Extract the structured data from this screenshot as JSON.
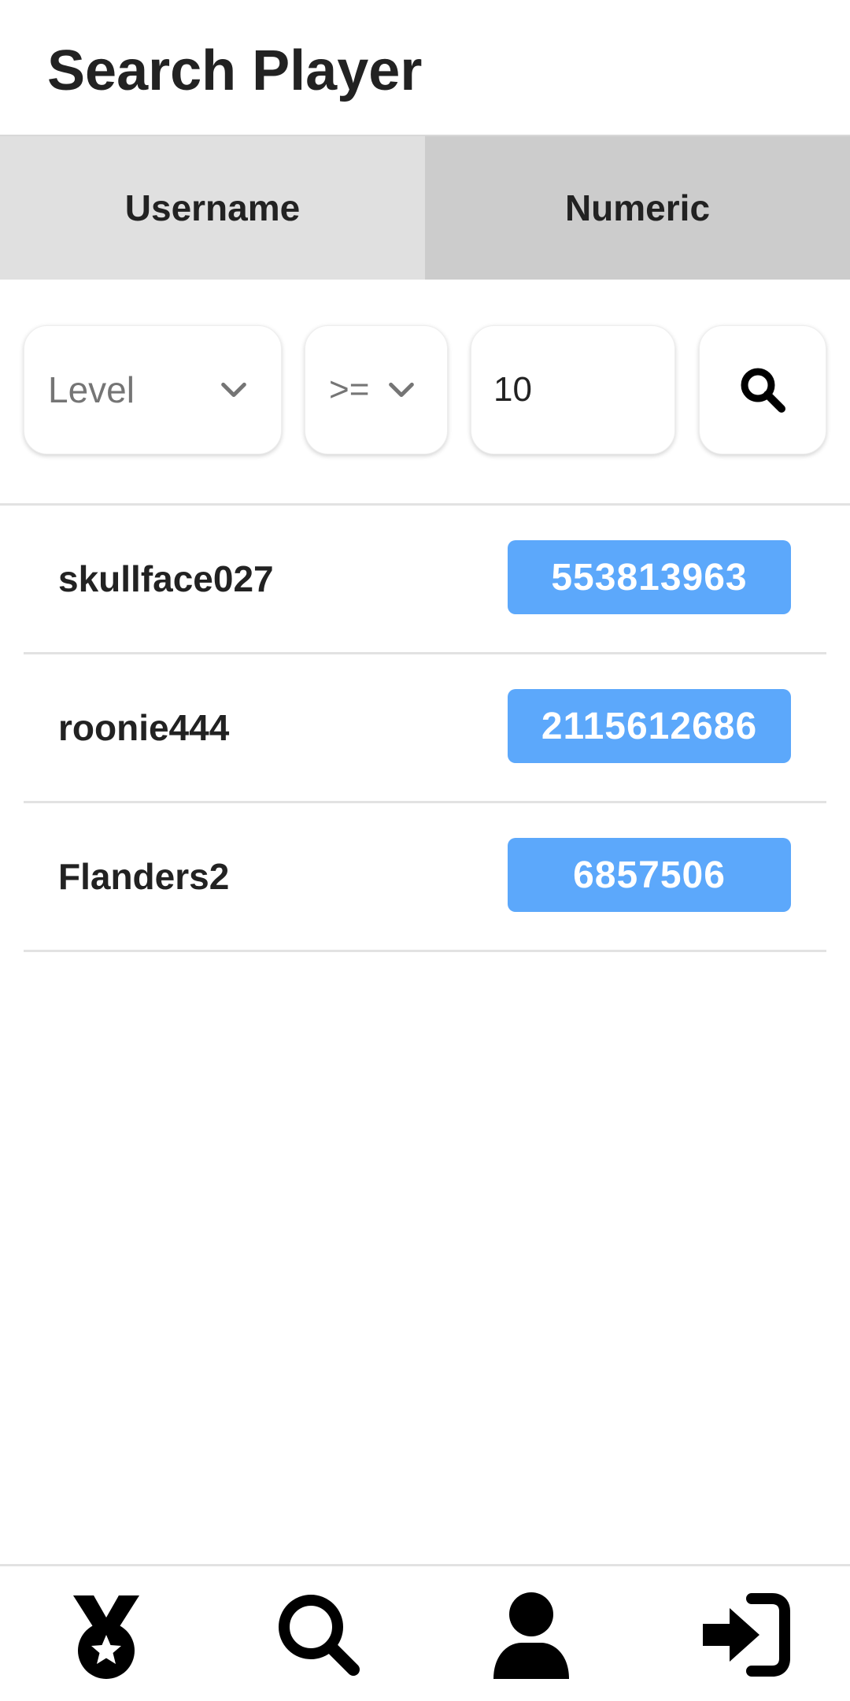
{
  "header": {
    "title": "Search Player"
  },
  "tabs": [
    {
      "label": "Username",
      "active": false
    },
    {
      "label": "Numeric",
      "active": true
    }
  ],
  "filters": {
    "field": {
      "selected": "Level",
      "icon": "chevron-down-icon"
    },
    "operator": {
      "selected": ">=",
      "icon": "chevron-down-icon"
    },
    "value": "10",
    "search_icon": "search-icon"
  },
  "results": [
    {
      "username": "skullface027",
      "id": "553813963"
    },
    {
      "username": "roonie444",
      "id": "2115612686"
    },
    {
      "username": "Flanders2",
      "id": "6857506"
    }
  ],
  "colors": {
    "badge": "#5ca8fb",
    "tab_inactive": "#e0e0e0",
    "tab_active": "#cccccc"
  },
  "bottom_nav": [
    {
      "icon": "medal-icon"
    },
    {
      "icon": "search-icon"
    },
    {
      "icon": "user-icon"
    },
    {
      "icon": "sign-in-icon"
    }
  ]
}
